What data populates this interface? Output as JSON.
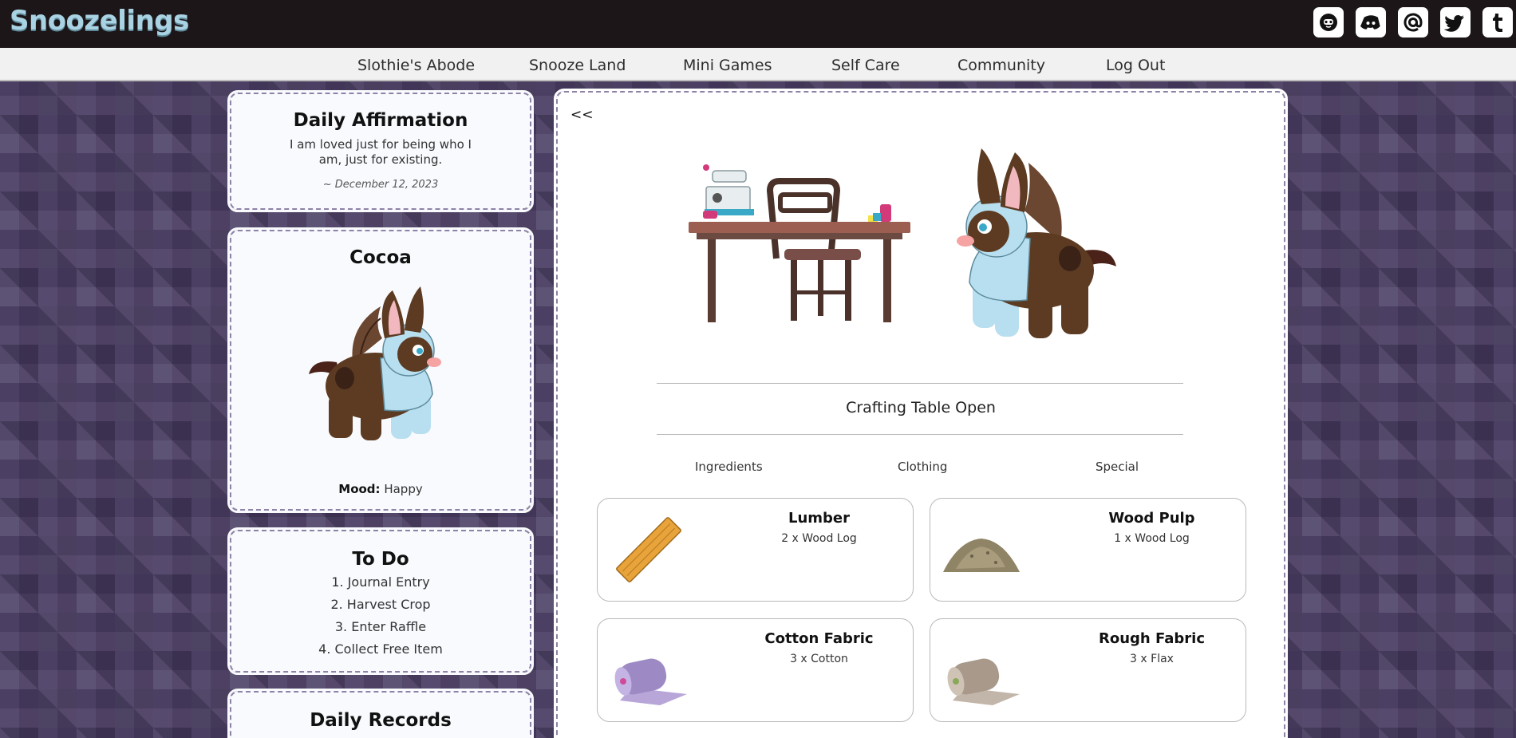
{
  "header": {
    "logo": "Snoozelings",
    "socials": [
      "pet-icon",
      "discord-icon",
      "at-icon",
      "twitter-icon",
      "tumblr-icon"
    ]
  },
  "nav": {
    "items": [
      "Slothie's Abode",
      "Snooze Land",
      "Mini Games",
      "Self Care",
      "Community",
      "Log Out"
    ]
  },
  "affirmation": {
    "title": "Daily Affirmation",
    "text": "I am loved just for being who I am, just for existing.",
    "date": "~ December 12, 2023"
  },
  "pet": {
    "name": "Cocoa",
    "mood_label": "Mood:",
    "mood_value": "Happy"
  },
  "todo": {
    "title": "To Do",
    "items": [
      "1. Journal Entry",
      "2. Harvest Crop",
      "3. Enter Raffle",
      "4. Collect Free Item"
    ]
  },
  "records": {
    "title": "Daily Records"
  },
  "crafting": {
    "back": "<<",
    "status": "Crafting Table Open",
    "tabs": [
      "Ingredients",
      "Clothing",
      "Special"
    ],
    "recipes": [
      {
        "name": "Lumber",
        "ingredients": "2 x Wood Log",
        "icon": "lumber-plank-icon"
      },
      {
        "name": "Wood Pulp",
        "ingredients": "1 x Wood Log",
        "icon": "wood-pulp-pile-icon"
      },
      {
        "name": "Cotton Fabric",
        "ingredients": "3 x Cotton",
        "icon": "cotton-fabric-roll-icon"
      },
      {
        "name": "Rough Fabric",
        "ingredients": "3 x Flax",
        "icon": "rough-fabric-roll-icon"
      }
    ]
  },
  "colors": {
    "topbar": "#1c1619",
    "logo": "#a9d3e3",
    "page_bg": "#4a3d63",
    "card_border": "#8e82a8"
  }
}
